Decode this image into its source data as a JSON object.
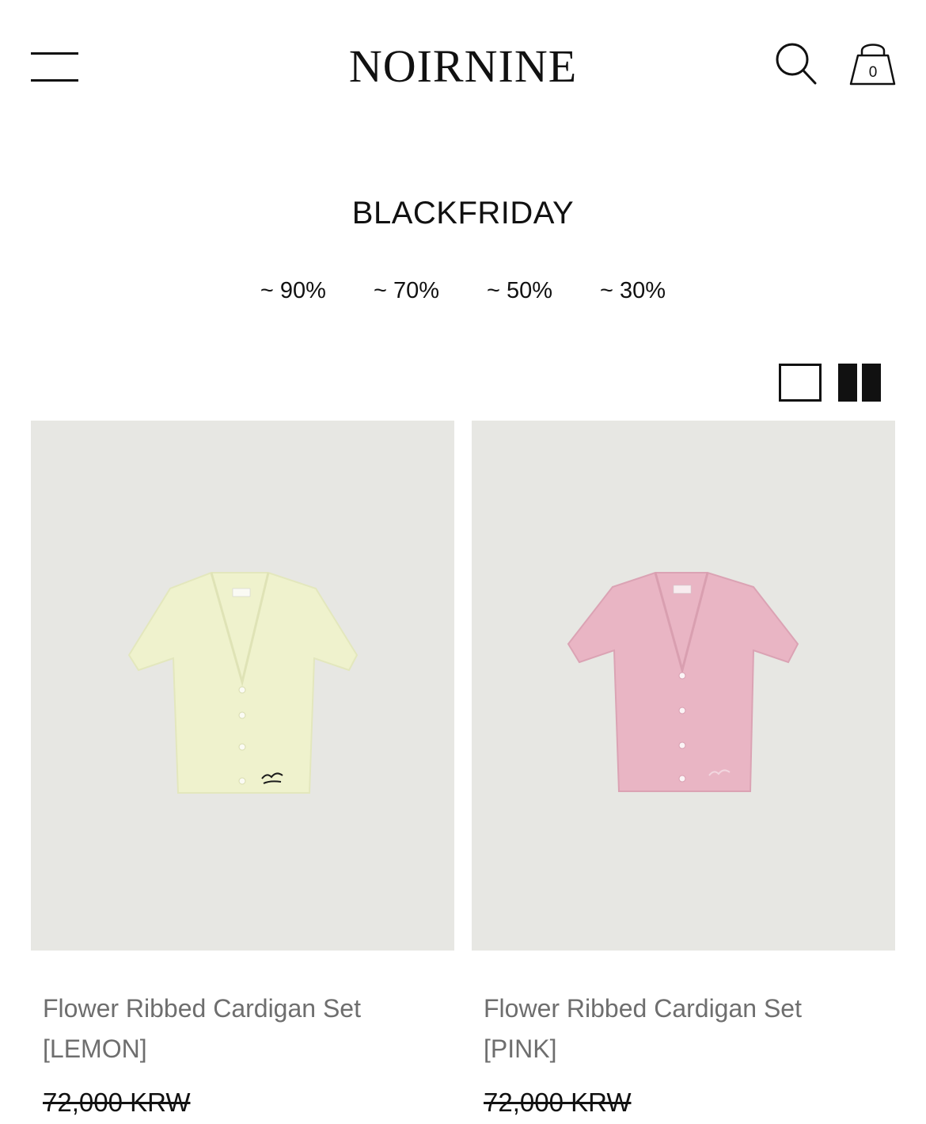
{
  "header": {
    "brand": "NOIRNINE",
    "cart_count": "0",
    "icons": [
      "hamburger-menu-icon",
      "search-icon",
      "shopping-bag-icon"
    ]
  },
  "page": {
    "title": "BLACKFRIDAY",
    "filters": [
      "~ 90%",
      "~ 70%",
      "~ 50%",
      "~ 30%"
    ]
  },
  "view_toggle": {
    "icons": [
      "single-column-view-icon",
      "two-column-view-icon"
    ]
  },
  "products": [
    {
      "name_line1": "Flower Ribbed Cardigan Set",
      "name_line2": "[LEMON]",
      "price": "72,000 KRW",
      "garment_color": "#eff2cd",
      "trim_color": "#e3e7bd",
      "logo_color": "#1b1b1b"
    },
    {
      "name_line1": "Flower Ribbed Cardigan Set",
      "name_line2": "[PINK]",
      "price": "72,000 KRW",
      "garment_color": "#e9b5c4",
      "trim_color": "#dba3b4",
      "logo_color": "#f2d6df"
    }
  ],
  "colors": {
    "image_background": "#e7e7e3",
    "text": "#111111",
    "product_name": "#6e6e6e"
  }
}
